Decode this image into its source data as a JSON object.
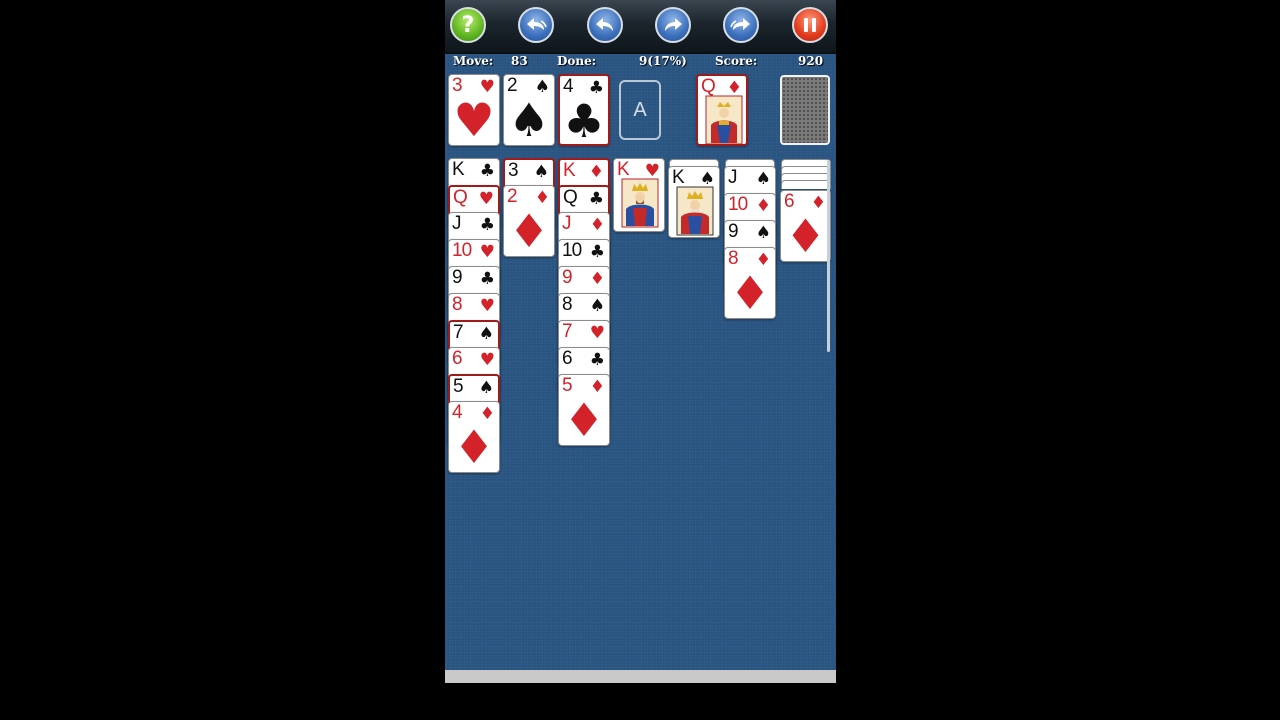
{
  "toolbar": {
    "help_symbol": "?",
    "colors": {
      "blue": "#3c6fbc",
      "green": "#5fb421",
      "red": "#e23a1c"
    }
  },
  "status": {
    "move_label": "Move:",
    "move_value": "83",
    "done_label": "Done:",
    "done_value": "9(17%)",
    "score_label": "Score:",
    "score_value": "920"
  },
  "foundations": [
    {
      "rank": "3",
      "suit": "♥",
      "color": "red"
    },
    {
      "rank": "2",
      "suit": "♠",
      "color": "black"
    },
    {
      "rank": "4",
      "suit": "♣",
      "color": "black"
    },
    {
      "empty_label": "A"
    }
  ],
  "waste": {
    "rank": "Q",
    "suit": "♦",
    "color": "red"
  },
  "tableau": [
    [
      {
        "rank": "K",
        "suit": "♣"
      },
      {
        "rank": "Q",
        "suit": "♥"
      },
      {
        "rank": "J",
        "suit": "♣"
      },
      {
        "rank": "10",
        "suit": "♥"
      },
      {
        "rank": "9",
        "suit": "♣"
      },
      {
        "rank": "8",
        "suit": "♥"
      },
      {
        "rank": "7",
        "suit": "♠"
      },
      {
        "rank": "6",
        "suit": "♥"
      },
      {
        "rank": "5",
        "suit": "♠"
      },
      {
        "rank": "4",
        "suit": "♦"
      }
    ],
    [
      {
        "rank": "3",
        "suit": "♠"
      },
      {
        "rank": "2",
        "suit": "♦"
      }
    ],
    [
      {
        "rank": "K",
        "suit": "♦"
      },
      {
        "rank": "Q",
        "suit": "♣"
      },
      {
        "rank": "J",
        "suit": "♦"
      },
      {
        "rank": "10",
        "suit": "♣"
      },
      {
        "rank": "9",
        "suit": "♦"
      },
      {
        "rank": "8",
        "suit": "♠"
      },
      {
        "rank": "7",
        "suit": "♥"
      },
      {
        "rank": "6",
        "suit": "♣"
      },
      {
        "rank": "5",
        "suit": "♦"
      }
    ],
    [
      {
        "rank": "K",
        "suit": "♥"
      }
    ],
    [
      {
        "rank": "K",
        "suit": "♠"
      }
    ],
    [
      {
        "rank": "J",
        "suit": "♠"
      },
      {
        "rank": "10",
        "suit": "♦"
      },
      {
        "rank": "9",
        "suit": "♠"
      },
      {
        "rank": "8",
        "suit": "♦"
      }
    ],
    [
      {
        "rank": "6",
        "suit": "♦"
      }
    ]
  ]
}
